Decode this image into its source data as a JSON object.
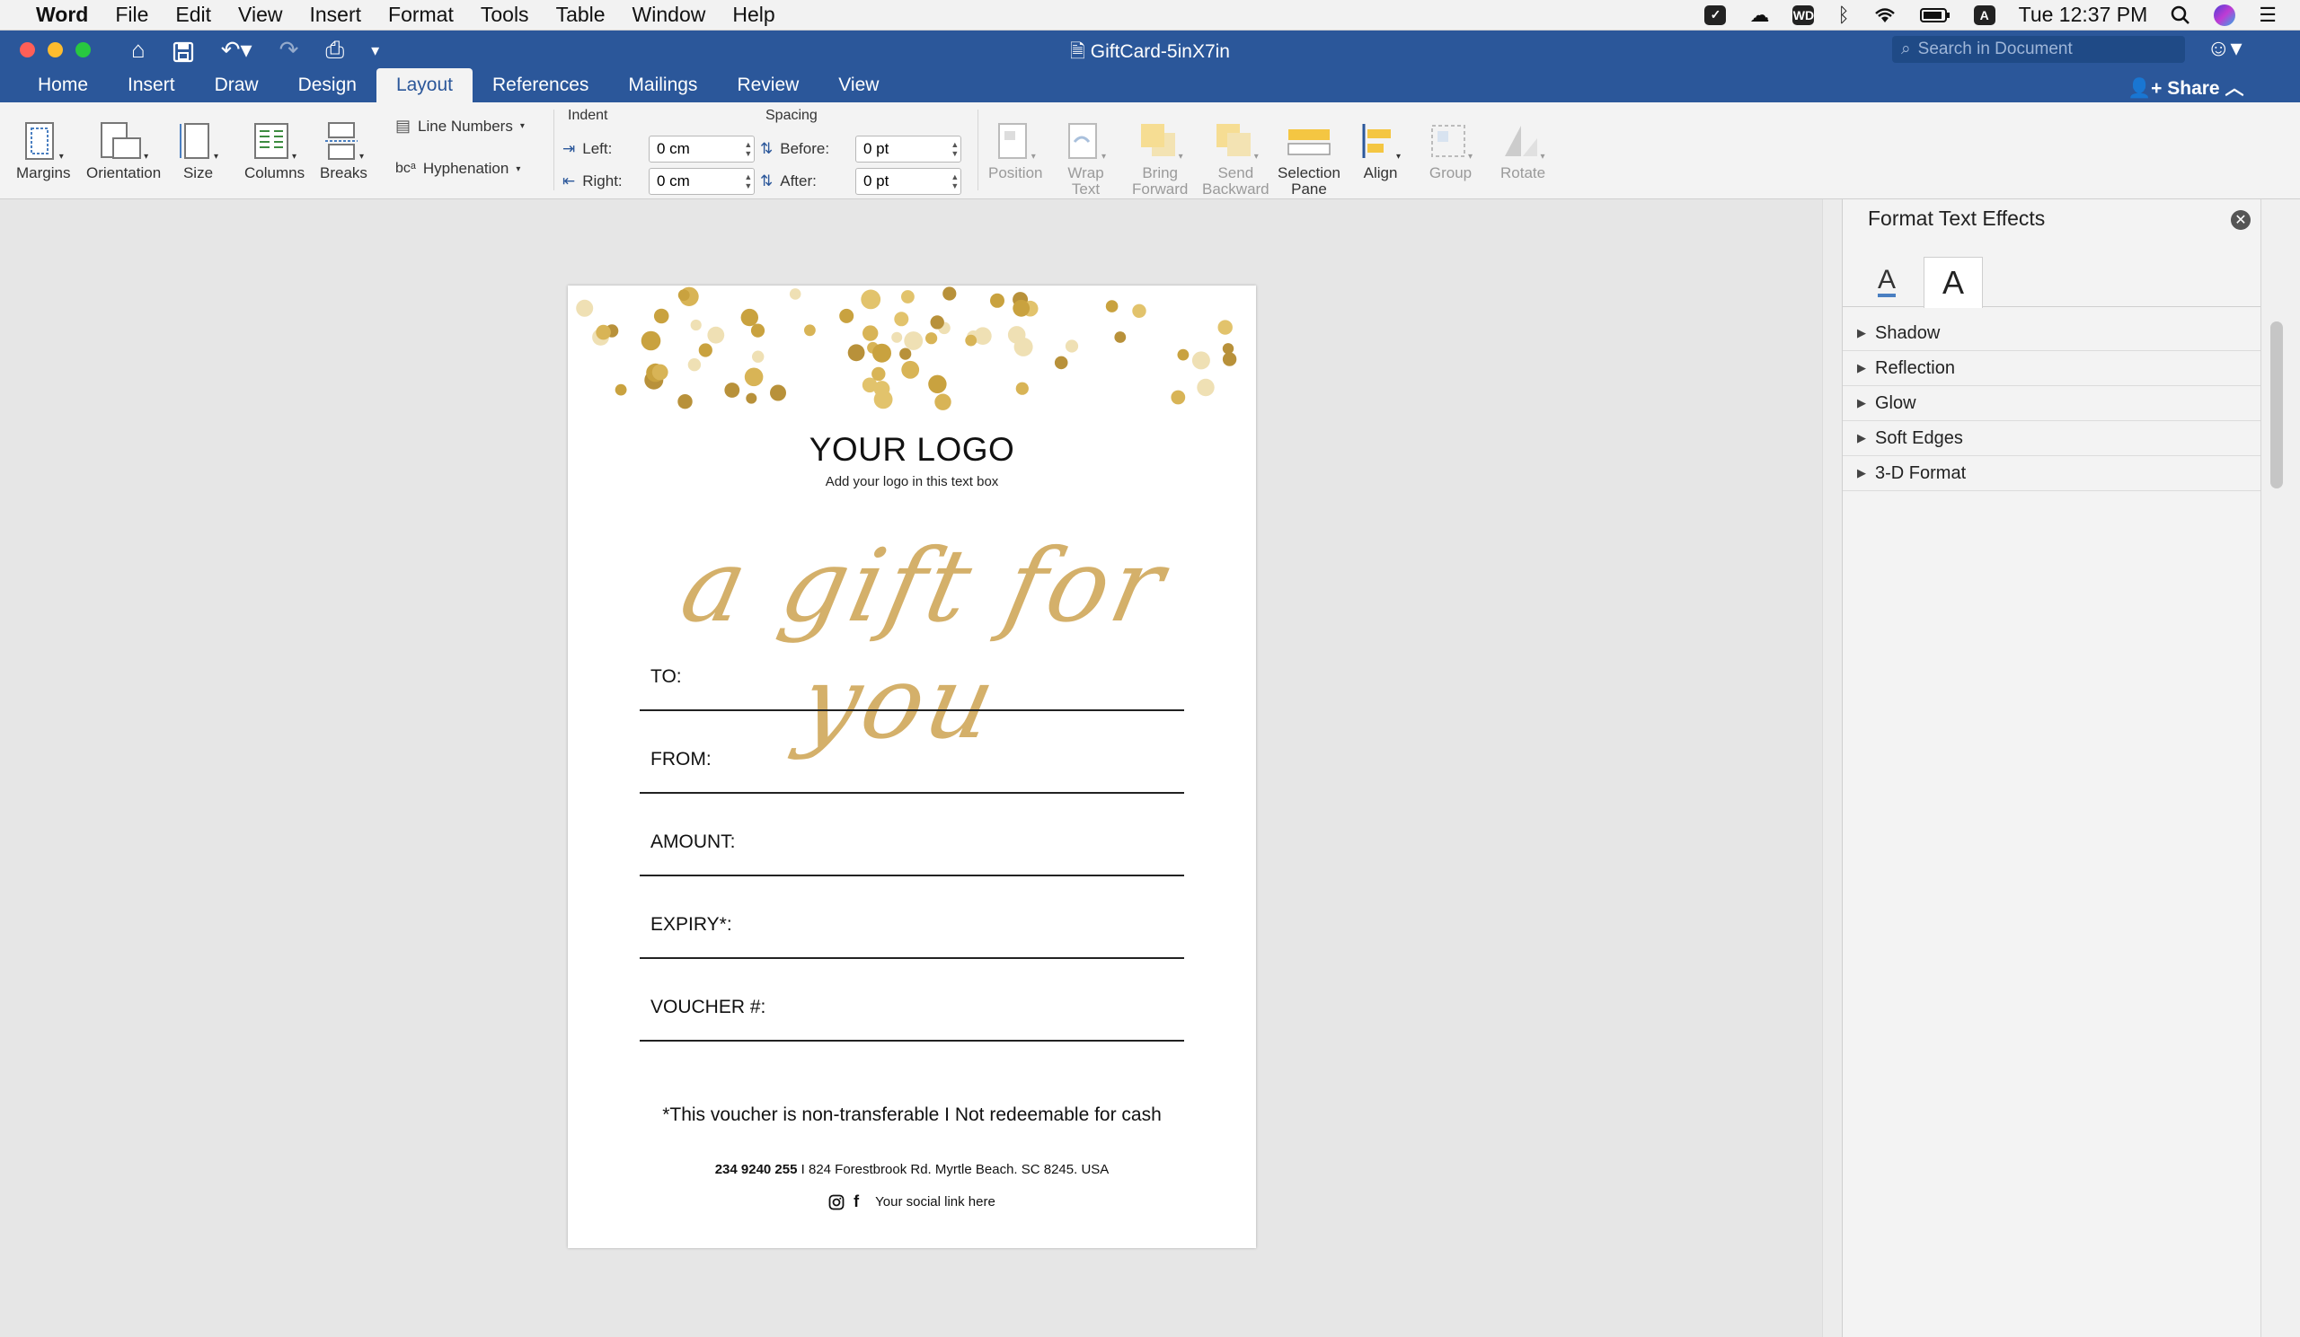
{
  "menubar": {
    "app": "Word",
    "items": [
      "File",
      "Edit",
      "View",
      "Insert",
      "Format",
      "Tools",
      "Table",
      "Window",
      "Help"
    ],
    "clock": "Tue 12:37 PM",
    "wd_badge": "WD",
    "a_badge": "A"
  },
  "titlebar": {
    "doc_title": "GiftCard-5inX7in",
    "search_placeholder": "Search in Document"
  },
  "tabs": {
    "items": [
      "Home",
      "Insert",
      "Draw",
      "Design",
      "Layout",
      "References",
      "Mailings",
      "Review",
      "View"
    ],
    "active": "Layout",
    "share": "Share"
  },
  "ribbon": {
    "margins": "Margins",
    "orientation": "Orientation",
    "size": "Size",
    "columns": "Columns",
    "breaks": "Breaks",
    "line_numbers": "Line Numbers",
    "hyphenation": "Hyphenation",
    "indent_title": "Indent",
    "spacing_title": "Spacing",
    "left_label": "Left:",
    "right_label": "Right:",
    "before_label": "Before:",
    "after_label": "After:",
    "left_value": "0 cm",
    "right_value": "0 cm",
    "before_value": "0 pt",
    "after_value": "0 pt",
    "position": "Position",
    "wrap_text": "Wrap\nText",
    "bring_forward": "Bring\nForward",
    "send_backward": "Send\nBackward",
    "selection_pane": "Selection\nPane",
    "align": "Align",
    "group": "Group",
    "rotate": "Rotate"
  },
  "document": {
    "logo": "YOUR LOGO",
    "logo_sub": "Add your logo in this text box",
    "script": "a gift for you",
    "fields": [
      "TO:",
      "FROM:",
      "AMOUNT:",
      "EXPIRY*:",
      "VOUCHER #:"
    ],
    "note": "*This voucher is non-transferable I Not redeemable for cash",
    "phone": "234 9240 255",
    "address": " I  824 Forestbrook Rd. Myrtle Beach. SC 8245. USA",
    "social": "Your social link here"
  },
  "pane": {
    "title": "Format Text Effects",
    "sections": [
      "Shadow",
      "Reflection",
      "Glow",
      "Soft Edges",
      "3-D Format"
    ]
  },
  "colors": {
    "word_blue": "#2b579a",
    "gold": "#d4b06a"
  }
}
